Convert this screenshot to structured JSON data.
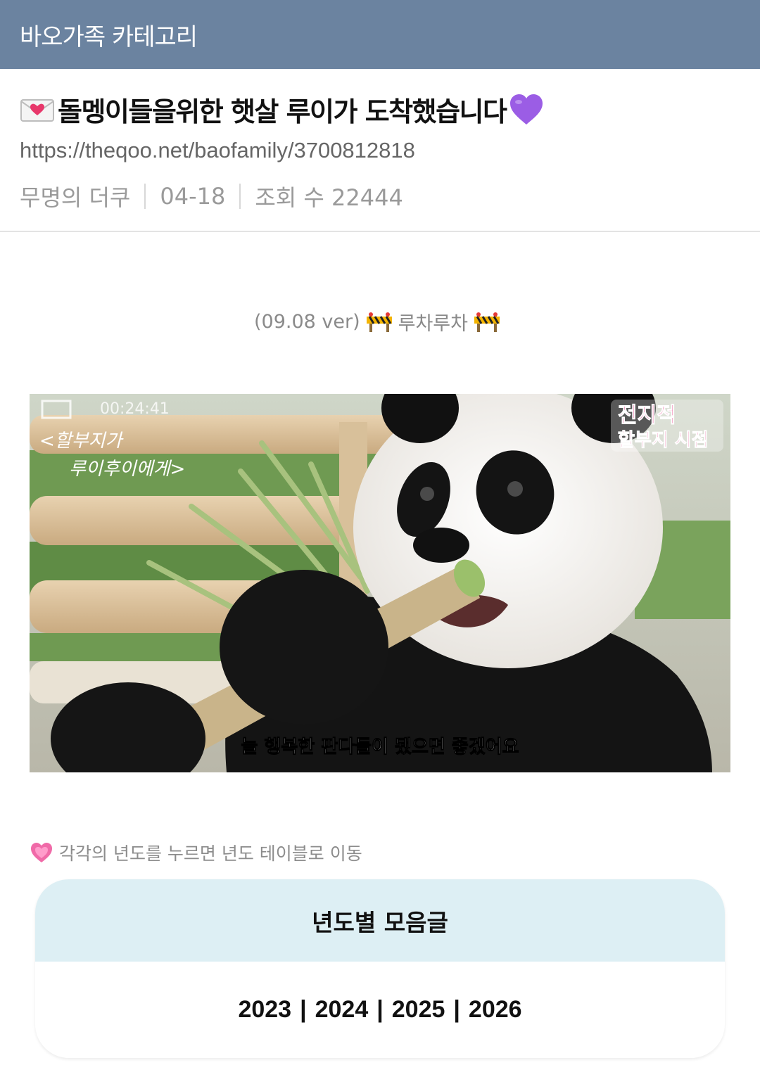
{
  "header": {
    "title": "바오가족 카테고리"
  },
  "post": {
    "title": "돌멩이들을위한 햇살 루이가 도착했습니다",
    "url": "https://theqoo.net/baofamily/3700812818",
    "author": "무명의 더쿠",
    "date": "04-18",
    "views": "조회 수 22444"
  },
  "content": {
    "version_prefix": "(09.08 ver)",
    "version_text": "루차루차",
    "image": {
      "caption": "늘 행복한 판다들이 됐으면 좋겠어요",
      "watermark_line1": "전지적",
      "watermark_line2": "할부지 시점",
      "handwriting_line1": "<할부지가",
      "handwriting_line2": "루이후이에게>",
      "timestamp": "00:24:41"
    },
    "hint": "각각의 년도를 누르면 년도 테이블로 이동"
  },
  "year_table": {
    "heading": "년도별 모음글",
    "years": [
      "2023",
      "2024",
      "2025",
      "2026"
    ]
  },
  "colors": {
    "header_bg": "#6b83a0",
    "card_header_bg": "#ddeff4"
  },
  "icons": [
    "love-letter-icon",
    "purple-heart-icon",
    "construction-barrier-icon",
    "sparkling-heart-icon"
  ]
}
